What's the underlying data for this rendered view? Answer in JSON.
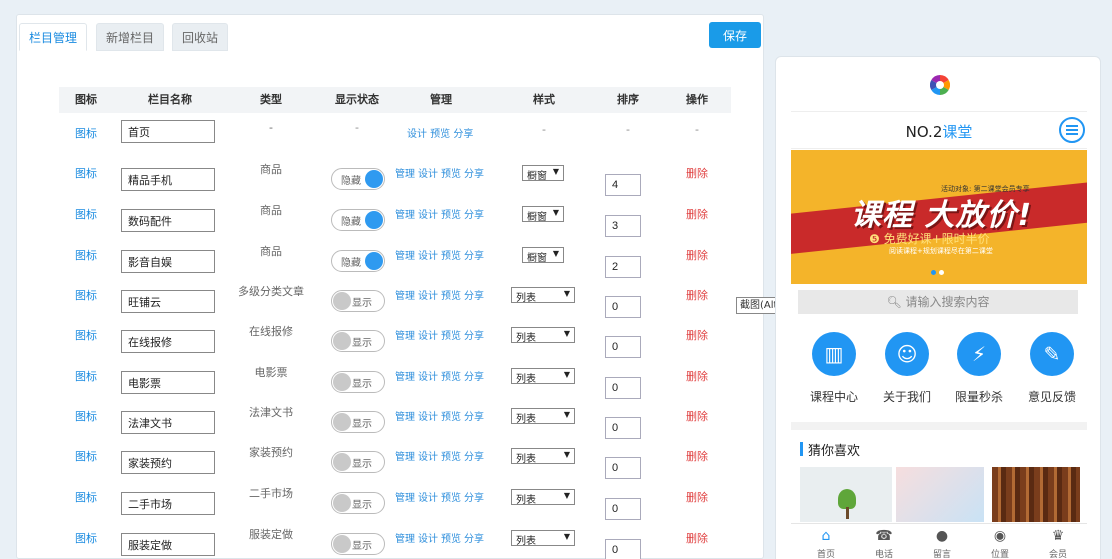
{
  "tabs": [
    "栏目管理",
    "新增栏目",
    "回收站"
  ],
  "save_label": "保存",
  "columns": [
    "图标",
    "栏目名称",
    "类型",
    "显示状态",
    "管理",
    "样式",
    "排序",
    "操作"
  ],
  "rows": [
    {
      "icon": "图标",
      "name": "首页",
      "type": "-",
      "status": "-",
      "mgmt": "设计 预览 分享",
      "style": "-",
      "order": "-",
      "op": "-"
    },
    {
      "icon": "图标",
      "name": "精品手机",
      "type": "商品",
      "status": "隐藏",
      "mgmt": [
        "管理",
        "设计",
        "预览",
        "分享"
      ],
      "style": "橱窗",
      "order": "4",
      "op": "删除"
    },
    {
      "icon": "图标",
      "name": "数码配件",
      "type": "商品",
      "status": "隐藏",
      "mgmt": [
        "管理",
        "设计",
        "预览",
        "分享"
      ],
      "style": "橱窗",
      "order": "3",
      "op": "删除"
    },
    {
      "icon": "图标",
      "name": "影音自娱",
      "type": "商品",
      "status": "隐藏",
      "mgmt": [
        "管理",
        "设计",
        "预览",
        "分享"
      ],
      "style": "橱窗",
      "order": "2",
      "op": "删除"
    },
    {
      "icon": "图标",
      "name": "旺铺云",
      "type": "多级分类文章",
      "status": "显示",
      "mgmt": [
        "管理",
        "设计",
        "预览",
        "分享"
      ],
      "style": "列表",
      "order": "0",
      "op": "删除"
    },
    {
      "icon": "图标",
      "name": "在线报修",
      "type": "在线报修",
      "status": "显示",
      "mgmt": [
        "管理",
        "设计",
        "预览",
        "分享"
      ],
      "style": "列表",
      "order": "0",
      "op": "删除"
    },
    {
      "icon": "图标",
      "name": "电影票",
      "type": "电影票",
      "status": "显示",
      "mgmt": [
        "管理",
        "设计",
        "预览",
        "分享"
      ],
      "style": "列表",
      "order": "0",
      "op": "删除"
    },
    {
      "icon": "图标",
      "name": "法津文书",
      "type": "法津文书",
      "status": "显示",
      "mgmt": [
        "管理",
        "设计",
        "预览",
        "分享"
      ],
      "style": "列表",
      "order": "0",
      "op": "删除"
    },
    {
      "icon": "图标",
      "name": "家装预约",
      "type": "家装预约",
      "status": "显示",
      "mgmt": [
        "管理",
        "设计",
        "预览",
        "分享"
      ],
      "style": "列表",
      "order": "0",
      "op": "删除"
    },
    {
      "icon": "图标",
      "name": "二手市场",
      "type": "二手市场",
      "status": "显示",
      "mgmt": [
        "管理",
        "设计",
        "预览",
        "分享"
      ],
      "style": "列表",
      "order": "0",
      "op": "删除"
    },
    {
      "icon": "图标",
      "name": "服装定做",
      "type": "服装定做",
      "status": "显示",
      "mgmt": [
        "管理",
        "设计",
        "预览",
        "分享"
      ],
      "style": "列表",
      "order": "0",
      "op": "删除"
    }
  ],
  "tooltip": "截图(Alt + A)",
  "phone": {
    "title_black": "NO.2",
    "title_blue": "课堂",
    "banner_big": "课程 大放价!",
    "banner_sub": "❺ 免费好课+限时半价",
    "banner_small": "阅读课程+规划课程尽在第二课堂",
    "banner_tag": "活动对象: 第二课堂会员专享",
    "search_placeholder": "请输入搜索内容",
    "quick": [
      {
        "label": "课程中心",
        "icon": "course-center-icon"
      },
      {
        "label": "关于我们",
        "icon": "about-us-icon"
      },
      {
        "label": "限量秒杀",
        "icon": "flash-sale-icon"
      },
      {
        "label": "意见反馈",
        "icon": "feedback-icon"
      }
    ],
    "section_title": "猜你喜欢",
    "bottom_nav": [
      "首页",
      "电话",
      "留言",
      "位置",
      "会员"
    ]
  },
  "colors": {
    "accent": "#1a8be0",
    "danger": "#e04040",
    "banner": "#f4b42a"
  }
}
